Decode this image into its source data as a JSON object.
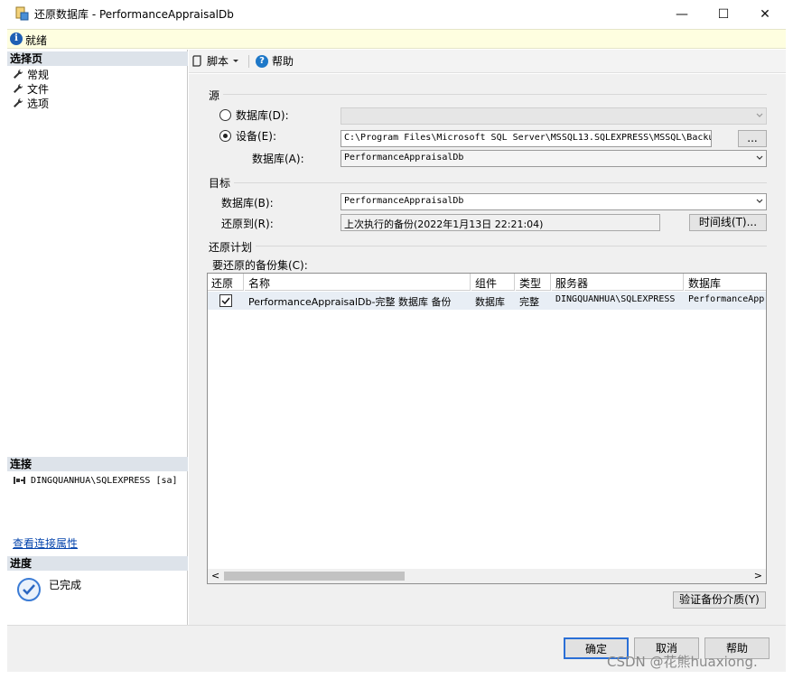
{
  "window": {
    "title": "还原数据库 - PerformanceAppraisalDb",
    "minimize": "—",
    "maximize": "☐",
    "close": "✕"
  },
  "status": {
    "text": "就绪"
  },
  "sidebar": {
    "select_page_header": "选择页",
    "pages": [
      {
        "label": "常规"
      },
      {
        "label": "文件"
      },
      {
        "label": "选项"
      }
    ],
    "connection_header": "连接",
    "connection_text": "DINGQUANHUA\\SQLEXPRESS [sa]",
    "connection_props_link": "查看连接属性",
    "progress_header": "进度",
    "progress_text": "已完成"
  },
  "toolbar": {
    "script_label": "脚本",
    "help_label": "帮助"
  },
  "source": {
    "group_label": "源",
    "database_radio_label": "数据库(D):",
    "device_radio_label": "设备(E):",
    "device_path": "C:\\Program Files\\Microsoft SQL Server\\MSSQL13.SQLEXPRESS\\MSSQL\\Backu",
    "browse_button": "...",
    "database_label": "数据库(A):",
    "database_value": "PerformanceAppraisalDb",
    "selected_option": "设备"
  },
  "destination": {
    "group_label": "目标",
    "database_label": "数据库(B):",
    "database_value": "PerformanceAppraisalDb",
    "restore_to_label": "还原到(R):",
    "restore_to_value": "上次执行的备份(2022年1月13日 22:21:04)",
    "timeline_button": "时间线(T)..."
  },
  "restore_plan": {
    "group_label": "还原计划",
    "backup_sets_label": "要还原的备份集(C):",
    "columns": [
      "还原",
      "名称",
      "组件",
      "类型",
      "服务器",
      "数据库"
    ],
    "rows": [
      {
        "restore": true,
        "name": "PerformanceAppraisalDb-完整 数据库 备份",
        "component": "数据库",
        "type": "完整",
        "server": "DINGQUANHUA\\SQLEXPRESS",
        "database": "PerformanceAppraisalDb"
      }
    ],
    "scroll_left": "<",
    "scroll_right": ">",
    "verify_button": "验证备份介质(Y)"
  },
  "footer": {
    "ok": "确定",
    "cancel": "取消",
    "help": "帮助"
  },
  "watermark": "CSDN @花熊huaxiong."
}
